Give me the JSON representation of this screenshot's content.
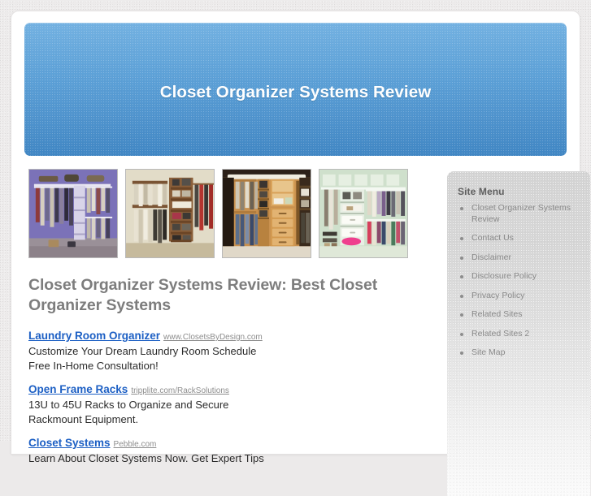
{
  "header": {
    "site_title": "Closet Organizer Systems Review"
  },
  "thumbnails": [
    {
      "name": "closet-purple-wall",
      "alt": "Purple walled closet with hanging clothes and white shelving"
    },
    {
      "name": "closet-wood-shelving",
      "alt": "Wood closet organizer with shelves and shoe racks"
    },
    {
      "name": "closet-oak-drawers",
      "alt": "Oak closet system with center drawer tower"
    },
    {
      "name": "closet-green-wire",
      "alt": "Green walled closet with white wire shelving"
    }
  ],
  "main": {
    "heading": "Closet Organizer Systems Review: Best Closet Organizer Systems",
    "ads": [
      {
        "title": "Laundry Room Organizer",
        "url": "www.ClosetsByDesign.com",
        "lines": [
          "Customize Your Dream Laundry Room Schedule",
          "Free In-Home Consultation!"
        ]
      },
      {
        "title": "Open Frame Racks",
        "url": "tripplite.com/RackSolutions",
        "lines": [
          "13U to 45U Racks to Organize and Secure",
          "Rackmount Equipment."
        ]
      },
      {
        "title": "Closet Systems",
        "url": "Pebble.com",
        "lines": [
          "Learn About Closet Systems Now. Get Expert Tips"
        ]
      }
    ]
  },
  "sidebar": {
    "title": "Site Menu",
    "items": [
      {
        "label": "Closet Organizer Systems Review"
      },
      {
        "label": "Contact Us"
      },
      {
        "label": "Disclaimer"
      },
      {
        "label": "Disclosure Policy"
      },
      {
        "label": "Privacy Policy"
      },
      {
        "label": "Related Sites"
      },
      {
        "label": "Related Sites 2"
      },
      {
        "label": "Site Map"
      }
    ]
  },
  "colors": {
    "header_top": "#74b2e2",
    "header_bottom": "#4187c4",
    "page_background": "#edebeb",
    "heading_text": "#7d7d7d",
    "ad_link": "#1c5fc4",
    "ad_url": "#8d8d8d",
    "sidebar_title": "#5f5f5f",
    "sidebar_item": "#8a8a8a"
  }
}
